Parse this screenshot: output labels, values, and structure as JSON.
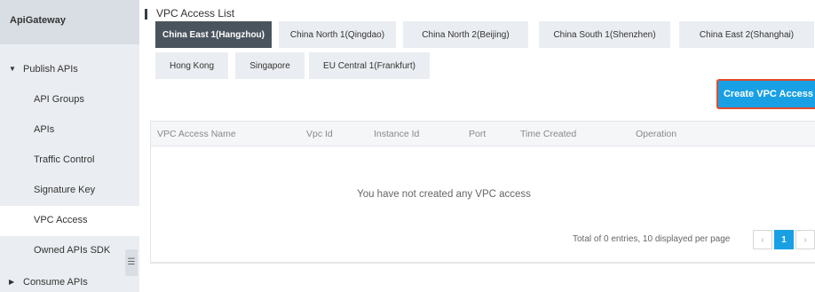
{
  "sidebar": {
    "brand": "ApiGateway",
    "publish_section": "Publish APIs",
    "items": [
      {
        "label": "API Groups"
      },
      {
        "label": "APIs"
      },
      {
        "label": "Traffic Control"
      },
      {
        "label": "Signature Key"
      },
      {
        "label": "VPC Access"
      },
      {
        "label": "Owned APIs SDK"
      }
    ],
    "consume_section": "Consume APIs",
    "collapse_icon": "☰"
  },
  "main": {
    "title": "VPC Access List",
    "regions": [
      "China East 1(Hangzhou)",
      "China North 1(Qingdao)",
      "China North 2(Beijing)",
      "China South 1(Shenzhen)",
      "China East 2(Shanghai)",
      "Hong Kong",
      "Singapore",
      "EU Central 1(Frankfurt)"
    ],
    "active_region": "China East 1(Hangzhou)",
    "create_button": "Create VPC Access",
    "table": {
      "columns": [
        "VPC Access Name",
        "Vpc Id",
        "Instance Id",
        "Port",
        "Time Created",
        "Operation"
      ],
      "empty_message": "You have not created any VPC access"
    },
    "pagination": {
      "summary": "Total of 0 entries, 10 displayed per page",
      "prev": "‹",
      "current_page": "1",
      "next": "›"
    }
  },
  "colors": {
    "sidebar_bg": "#eaedf1",
    "active_tab": "#4a545e",
    "primary": "#19a0e4",
    "highlight_border": "#e34a2b"
  }
}
